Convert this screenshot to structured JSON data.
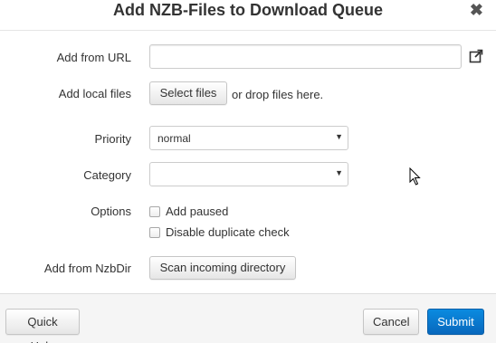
{
  "dialog": {
    "title": "Add NZB-Files to Download Queue",
    "close_symbol": "✖"
  },
  "form": {
    "url": {
      "label": "Add from URL",
      "value": "",
      "placeholder": "",
      "icon": "external-link-icon"
    },
    "local_files": {
      "label": "Add local files",
      "button_label": "Select files",
      "hint": "or drop files here."
    },
    "priority": {
      "label": "Priority",
      "selected": "normal"
    },
    "category": {
      "label": "Category",
      "selected": ""
    },
    "options": {
      "label": "Options",
      "add_paused": {
        "label": "Add paused",
        "checked": false
      },
      "disable_duplicate_check": {
        "label": "Disable duplicate check",
        "checked": false
      }
    },
    "nzbdir": {
      "label": "Add from NzbDir",
      "button_label": "Scan incoming directory"
    }
  },
  "footer": {
    "quick_help_label": "Quick Help",
    "cancel_label": "Cancel",
    "submit_label": "Submit"
  },
  "colors": {
    "primary": "#0a72cf",
    "footer_bg": "#f5f5f5"
  }
}
